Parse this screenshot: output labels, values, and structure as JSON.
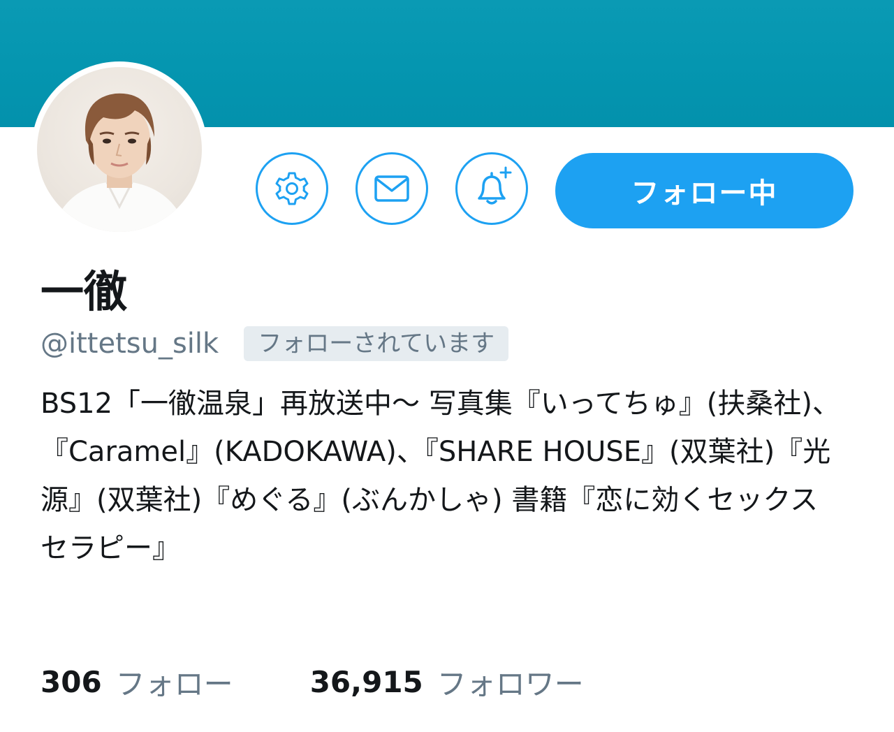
{
  "profile": {
    "display_name": "一徹",
    "handle": "@ittetsu_silk",
    "follows_you_label": "フォローされています",
    "bio": "BS12「一徹温泉」再放送中〜 写真集『いってちゅ』(扶桑社)、『Caramel』(KADOKAWA)、『SHARE HOUSE』(双葉社)『光源』(双葉社)『めぐる』(ぶんかしゃ) 書籍『恋に効くセックスセラピー』"
  },
  "actions": {
    "settings_icon": "gear-icon",
    "message_icon": "envelope-icon",
    "notify_icon": "bell-plus-icon",
    "follow_button_label": "フォロー中"
  },
  "stats": {
    "following_count": "306",
    "following_label": "フォロー",
    "followers_count": "36,915",
    "followers_label": "フォロワー"
  },
  "colors": {
    "banner": "#0596b0",
    "accent": "#1da1f2",
    "secondary_text": "#657786",
    "badge_bg": "#e6ecf0"
  }
}
